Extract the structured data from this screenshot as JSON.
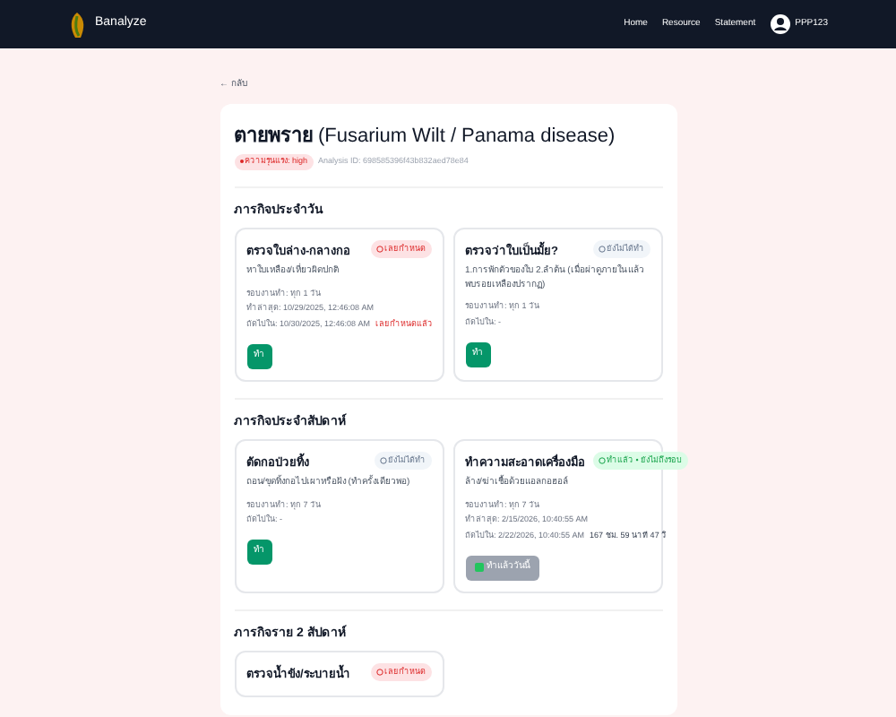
{
  "nav": {
    "brand": "Banalyze",
    "links": [
      "Home",
      "Resource",
      "Statement"
    ],
    "user": "PPP123"
  },
  "back": "← กลับ",
  "header": {
    "title_thai": "ตายพราย",
    "title_en": "(Fusarium Wilt / Panama disease)",
    "risk": "ความรุนแรง: high",
    "analysis_id": "Analysis ID: 698585396f43b832aed78e84"
  },
  "sections": [
    {
      "title": "ภารกิจประจำวัน",
      "tasks": [
        {
          "title": "ตรวจใบล่าง-กลางกอ",
          "desc": "หาใบเหลือง/เหี่ยวผิดปกติ",
          "status": {
            "kind": "overdue",
            "label": "เลยกำหนด"
          },
          "lines": [
            "รอบงานทำ: ทุก 1 วัน",
            "ทำล่าสุด: 10/29/2025, 12:46:08 AM",
            "ถัดไปใน: 10/30/2025, 12:46:08 AM"
          ],
          "note": {
            "kind": "overdue",
            "text": "เลยกำหนดแล้ว"
          },
          "button": {
            "kind": "do",
            "label": "ทำ"
          }
        },
        {
          "title": "ตรวจว่าใบเป็นมั้ย?",
          "desc": "1.การพักตัวของใบ 2.ลำต้น (เมื่อผ่าดูภายใน แล้วพบรอยเหลืองปรากฏ)",
          "status": {
            "kind": "pending",
            "label": "ยังไม่ได้ทำ"
          },
          "lines": [
            "รอบงานทำ: ทุก 1 วัน",
            "ถัดไปใน: -"
          ],
          "button": {
            "kind": "do",
            "label": "ทำ"
          }
        }
      ]
    },
    {
      "title": "ภารกิจประจำสัปดาห์",
      "tasks": [
        {
          "title": "ตัดกอป่วยทิ้ง",
          "desc": "ถอน/ขุดทิ้งกอไปเผาหรือฝัง (ทำครั้งเดียวพอ)",
          "status": {
            "kind": "pending",
            "label": "ยังไม่ได้ทำ"
          },
          "lines": [
            "รอบงานทำ: ทุก 7 วัน",
            "ถัดไปใน: -"
          ],
          "button": {
            "kind": "do",
            "label": "ทำ"
          }
        },
        {
          "title": "ทำความสะอาดเครื่องมือ",
          "desc": "ล้าง/ฆ่าเชื้อด้วยแอลกอฮอล์",
          "status": {
            "kind": "done",
            "label": "ทำแล้ว • ยังไม่ถึงรอบ"
          },
          "lines": [
            "รอบงานทำ: ทุก 7 วัน",
            "ทำล่าสุด: 2/15/2026, 10:40:55 AM",
            "ถัดไปใน: 2/22/2026, 10:40:55 AM"
          ],
          "note": {
            "kind": "countdown",
            "text": "167 ชม. 59 นาที 47 วิ"
          },
          "button": {
            "kind": "done",
            "label": "ทำแล้ววันนี้"
          }
        }
      ]
    },
    {
      "title": "ภารกิจราย 2 สัปดาห์",
      "tasks": [
        {
          "title": "ตรวจน้ำขัง/ระบายน้ำ",
          "status": {
            "kind": "overdue",
            "label": "เลยกำหนด"
          }
        }
      ]
    }
  ]
}
